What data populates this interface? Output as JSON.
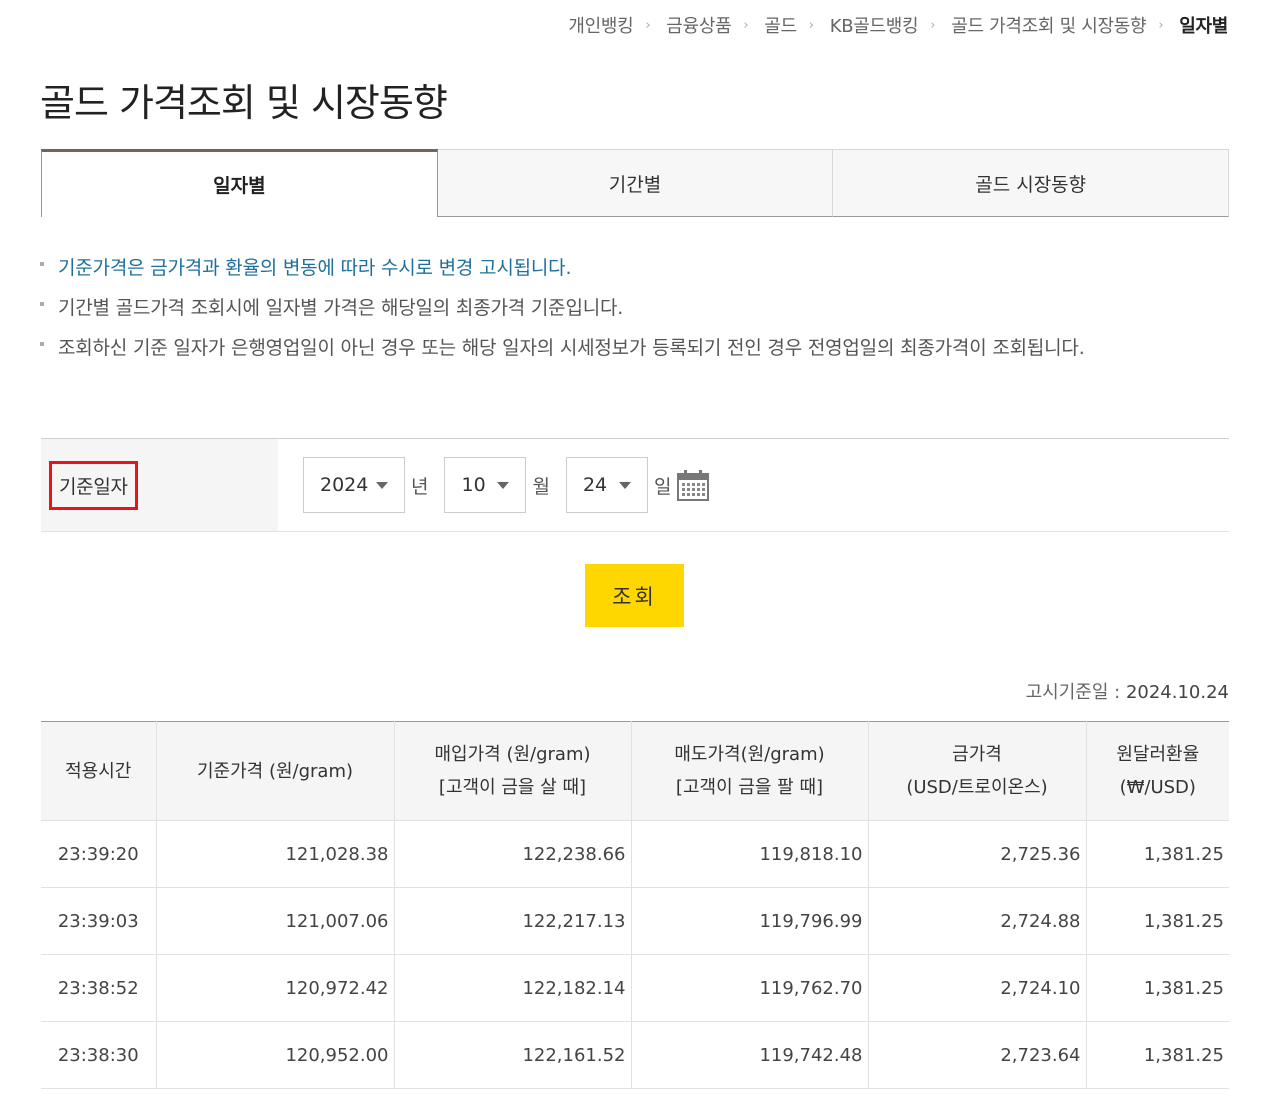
{
  "breadcrumb": [
    "개인뱅킹",
    "금융상품",
    "골드",
    "KB골드뱅킹",
    "골드 가격조회 및 시장동향",
    "일자별"
  ],
  "page_title": "골드 가격조회 및 시장동향",
  "tabs": [
    {
      "label": "일자별",
      "active": true
    },
    {
      "label": "기간별",
      "active": false
    },
    {
      "label": "골드 시장동향",
      "active": false
    }
  ],
  "notes": [
    "기준가격은 금가격과 환율의 변동에 따라 수시로 변경 고시됩니다.",
    "기간별 골드가격 조회시에 일자별 가격은 해당일의 최종가격 기준입니다.",
    "조회하신 기준 일자가 은행영업일이 아닌 경우 또는 해당 일자의 시세정보가 등록되기 전인 경우 전영업일의 최종가격이 조회됩니다."
  ],
  "search": {
    "label": "기준일자",
    "year": "2024",
    "year_unit": "년",
    "month": "10",
    "month_unit": "월",
    "day": "24",
    "day_unit": "일",
    "button": "조회",
    "calendar_icon": "calendar-icon"
  },
  "notice_date": {
    "label": "고시기준일 : ",
    "value": "2024.10.24"
  },
  "table": {
    "headers": [
      [
        "적용시간"
      ],
      [
        "기준가격 (원/gram)"
      ],
      [
        "매입가격 (원/gram)",
        "[고객이 금을 살 때]"
      ],
      [
        "매도가격(원/gram)",
        "[고객이 금을 팔 때]"
      ],
      [
        "금가격",
        "(USD/트로이온스)"
      ],
      [
        "원달러환율",
        "(₩/USD)"
      ]
    ],
    "rows": [
      [
        "23:39:20",
        "121,028.38",
        "122,238.66",
        "119,818.10",
        "2,725.36",
        "1,381.25"
      ],
      [
        "23:39:03",
        "121,007.06",
        "122,217.13",
        "119,796.99",
        "2,724.88",
        "1,381.25"
      ],
      [
        "23:38:52",
        "120,972.42",
        "122,182.14",
        "119,762.70",
        "2,724.10",
        "1,381.25"
      ],
      [
        "23:38:30",
        "120,952.00",
        "122,161.52",
        "119,742.48",
        "2,723.64",
        "1,381.25"
      ]
    ]
  },
  "colors": {
    "accent": "#ffd700",
    "tab_top": "#6e6659",
    "highlight_box": "#e8141c",
    "note_blue": "#1f6f9c"
  }
}
